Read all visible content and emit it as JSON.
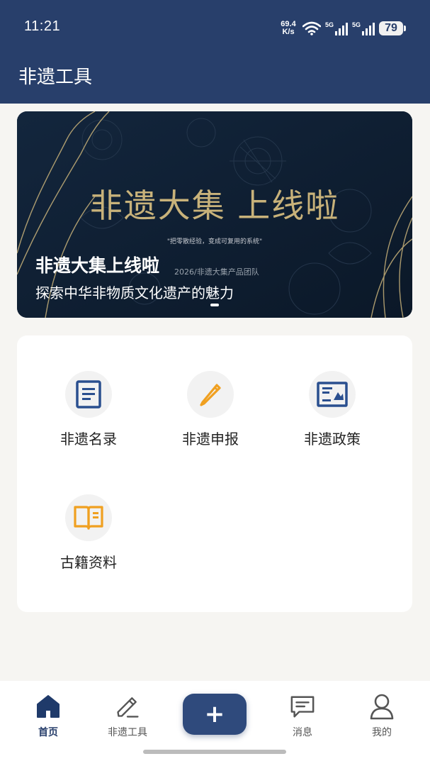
{
  "status_bar": {
    "time": "11:21",
    "net_speed_value": "69.4",
    "net_speed_unit": "K/s",
    "signal1_tag": "5G",
    "signal2_tag": "5G",
    "battery": "79"
  },
  "header": {
    "title": "非遗工具"
  },
  "banner": {
    "big_title": "非遗大集 上线啦",
    "slogan": "\"把零散经验，变成可复用的系统\"",
    "title": "非遗大集上线啦",
    "team": "2026/非遗大集产品团队",
    "subtitle": "探索中华非物质文化遗产的魅力"
  },
  "menu": {
    "items": [
      {
        "label": "非遗名录",
        "icon": "document-icon",
        "color": "#2a4f8f"
      },
      {
        "label": "非遗申报",
        "icon": "pencil-icon",
        "color": "#f0a020"
      },
      {
        "label": "非遗政策",
        "icon": "newspaper-icon",
        "color": "#2a4f8f"
      },
      {
        "label": "古籍资料",
        "icon": "book-icon",
        "color": "#f0a020"
      }
    ]
  },
  "tabbar": {
    "home": "首页",
    "tools": "非遗工具",
    "add": "+",
    "messages": "消息",
    "profile": "我的"
  },
  "colors": {
    "primary": "#283f6b",
    "accent": "#f0a020",
    "background": "#f6f5f2"
  }
}
